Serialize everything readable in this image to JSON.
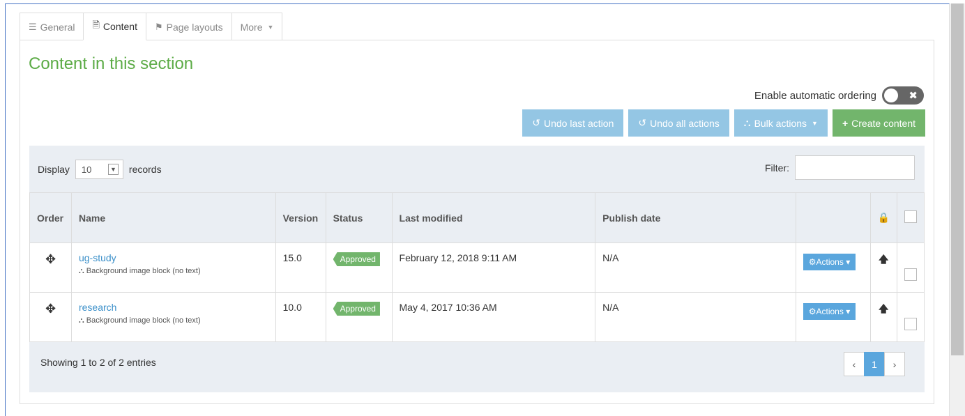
{
  "tabs": [
    {
      "label": "General",
      "icon": "sliders-icon"
    },
    {
      "label": "Content",
      "icon": "document-icon"
    },
    {
      "label": "Page layouts",
      "icon": "puzzle-icon"
    },
    {
      "label": "More",
      "icon": "caret-down-icon"
    }
  ],
  "section": {
    "title": "Content in this section",
    "auto_ordering_label": "Enable automatic ordering",
    "auto_ordering_enabled": false
  },
  "buttons": {
    "undo_last": "Undo last action",
    "undo_all": "Undo all actions",
    "bulk": "Bulk actions",
    "create": "Create content"
  },
  "table_controls": {
    "display_label": "Display",
    "records_value": "10",
    "records_label": "records",
    "filter_label": "Filter:",
    "filter_value": ""
  },
  "columns": [
    "Order",
    "Name",
    "Version",
    "Status",
    "Last modified",
    "Publish date",
    "",
    "",
    ""
  ],
  "rows": [
    {
      "name": "ug-study",
      "type": "Background image block (no text)",
      "version": "15.0",
      "status": "Approved",
      "last_modified": "February 12, 2018 9:11 AM",
      "publish_date": "N/A",
      "actions": "Actions"
    },
    {
      "name": "research",
      "type": "Background image block (no text)",
      "version": "10.0",
      "status": "Approved",
      "last_modified": "May 4, 2017 10:36 AM",
      "publish_date": "N/A",
      "actions": "Actions"
    }
  ],
  "footer": {
    "showing": "Showing 1 to 2 of 2 entries",
    "prev": "‹",
    "page": "1",
    "next": "›"
  },
  "colors": {
    "accent_green": "#5cab46",
    "button_blue": "#94c6e4",
    "button_green": "#72b56c",
    "link_blue": "#3a8fc9"
  }
}
